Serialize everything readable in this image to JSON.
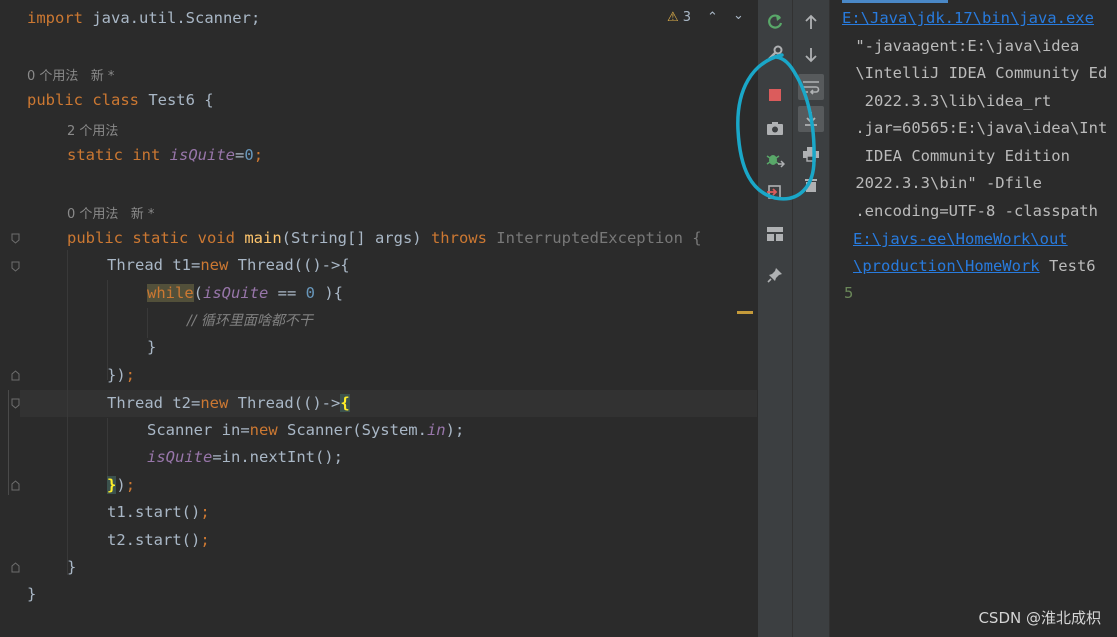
{
  "editor": {
    "warnings": {
      "count": "3"
    },
    "lines": {
      "l1": {
        "kw": "import",
        "rest": " java.util.Scanner;"
      },
      "h1": "0 个用法   新 *",
      "l2": {
        "kw": "public class",
        "name": " Test6 {"
      },
      "h2": "2 个用法",
      "l3": {
        "kw": "static int",
        "fld": "isQuite",
        "eq": "=",
        "num": "0",
        "semi": ";"
      },
      "h3": "0 个用法   新 *",
      "l4": {
        "kw": "public static void",
        "fn": "main",
        "args": "(String[] args) ",
        "throws": "throws",
        "exc": " InterruptedException {"
      },
      "l5": {
        "a": "Thread t1=",
        "kw": "new",
        "b": " Thread(()->{"
      },
      "l6": {
        "kw": "while",
        "p": "(",
        "fld": "isQuite",
        "op": " == ",
        "num": "0",
        "end": " ){"
      },
      "l7": {
        "cmt": "// 循环里面啥都不干"
      },
      "l8": "}",
      "l9": {
        "a": "})",
        "semi": ";"
      },
      "l10": {
        "a": "Thread t2=",
        "kw": "new",
        "b": " Thread(()->",
        "brace": "{"
      },
      "l11": {
        "a": "Scanner in=",
        "kw": "new",
        "b": " Scanner(System.",
        "fld": "in",
        "c": ");"
      },
      "l12": {
        "fld": "isQuite",
        "b": "=in.nextInt();"
      },
      "l13": {
        "brace": "}",
        "a": ")",
        "semi": ";"
      },
      "l14": {
        "a": "t1.start()",
        "semi": ";"
      },
      "l15": {
        "a": "t2.start()",
        "semi": ";"
      },
      "l16": "}",
      "l17": "}"
    }
  },
  "console": {
    "lines": [
      {
        "text": "E:\\Java\\jdk.17\\bin\\java.exe",
        "kind": "link"
      },
      {
        "text": " \"-javaagent:E:\\java\\idea",
        "kind": "text"
      },
      {
        "text": " \\IntelliJ IDEA Community Ed",
        "kind": "text"
      },
      {
        "text": "  2022.3.3\\lib\\idea_rt",
        "kind": "text"
      },
      {
        "text": " .jar=60565:E:\\java\\idea\\Int",
        "kind": "text"
      },
      {
        "text": "  IDEA Community Edition",
        "kind": "text"
      },
      {
        "text": " 2022.3.3\\bin\" -Dfile",
        "kind": "text"
      },
      {
        "text": " .encoding=UTF-8 -classpath",
        "kind": "text"
      },
      {
        "text": "E:\\javs-ee\\HomeWork\\out",
        "kind": "link"
      },
      {
        "text": "\\production\\HomeWork",
        "kind": "link",
        "suffix": " Test6"
      },
      {
        "text": "5",
        "kind": "output"
      }
    ]
  },
  "toolbar_left": [
    "rerun-icon",
    "wrench-icon",
    "stop-icon",
    "camera-icon",
    "debug-icon",
    "exit-icon",
    "layout-icon",
    "pin-icon"
  ],
  "toolbar_right": [
    "arrow-up-icon",
    "arrow-down-icon",
    "soft-wrap-icon",
    "scroll-end-icon",
    "print-icon",
    "trash-icon"
  ],
  "annotation": {
    "color": "#1aa7c8"
  },
  "watermark": "CSDN @淮北成枳"
}
